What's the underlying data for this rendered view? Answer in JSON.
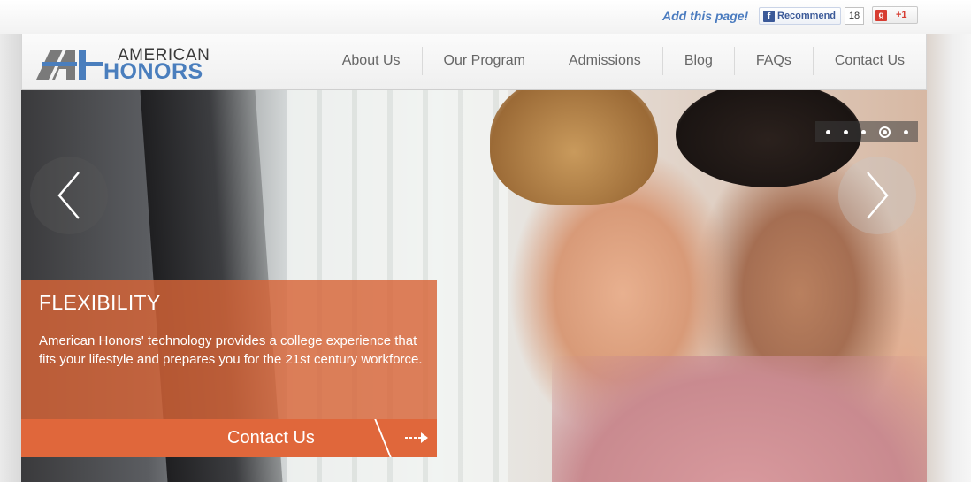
{
  "social": {
    "add_page": "Add this page!",
    "fb_label": "Recommend",
    "fb_count": "18",
    "gplus_label": "+1"
  },
  "logo": {
    "line1": "AMERICAN",
    "line2": "HONORS",
    "brand_color": "#4a7ebd"
  },
  "nav": {
    "items": [
      "About Us",
      "Our Program",
      "Admissions",
      "Blog",
      "FAQs",
      "Contact Us"
    ]
  },
  "slider": {
    "dot_count": 5,
    "active_dot": 4,
    "panel_title": "FLEXIBILITY",
    "panel_text": "American Honors' technology provides a college experience that fits your lifestyle and prepares you for the 21st century workforce.",
    "cta_label": "Contact Us",
    "accent_color": "#e0673b"
  },
  "icons": [
    "facebook-icon",
    "google-plus-icon",
    "chevron-left-icon",
    "chevron-right-icon",
    "arrow-right-icon"
  ]
}
